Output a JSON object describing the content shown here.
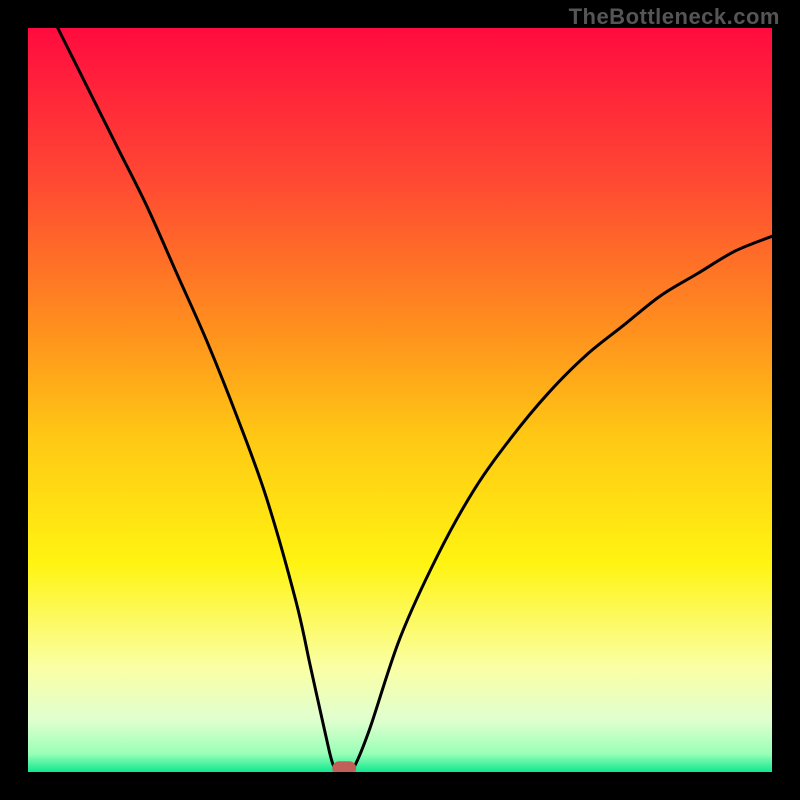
{
  "watermark": "TheBottleneck.com",
  "chart_data": {
    "type": "line",
    "title": "",
    "xlabel": "",
    "ylabel": "",
    "xlim": [
      0,
      100
    ],
    "ylim": [
      0,
      100
    ],
    "grid": false,
    "legend": false,
    "series": [
      {
        "name": "curve",
        "x": [
          4,
          8,
          12,
          16,
          20,
          24,
          28,
          32,
          36,
          38,
          40,
          41,
          42,
          43,
          44,
          46,
          50,
          55,
          60,
          65,
          70,
          75,
          80,
          85,
          90,
          95,
          100
        ],
        "y": [
          100,
          92,
          84,
          76,
          67,
          58,
          48,
          37,
          23,
          14,
          5,
          1,
          0,
          0,
          1,
          6,
          18,
          29,
          38,
          45,
          51,
          56,
          60,
          64,
          67,
          70,
          72
        ]
      }
    ],
    "marker": {
      "x": 42.5,
      "y": 0.5,
      "color": "#c06058"
    },
    "background_gradient": {
      "stops": [
        {
          "offset": 0.0,
          "color": "#ff0b3f"
        },
        {
          "offset": 0.2,
          "color": "#ff4733"
        },
        {
          "offset": 0.4,
          "color": "#ff8e1e"
        },
        {
          "offset": 0.55,
          "color": "#ffc814"
        },
        {
          "offset": 0.72,
          "color": "#fff412"
        },
        {
          "offset": 0.86,
          "color": "#faffa5"
        },
        {
          "offset": 0.93,
          "color": "#e0ffcf"
        },
        {
          "offset": 0.975,
          "color": "#9affb8"
        },
        {
          "offset": 1.0,
          "color": "#10e890"
        }
      ]
    }
  }
}
